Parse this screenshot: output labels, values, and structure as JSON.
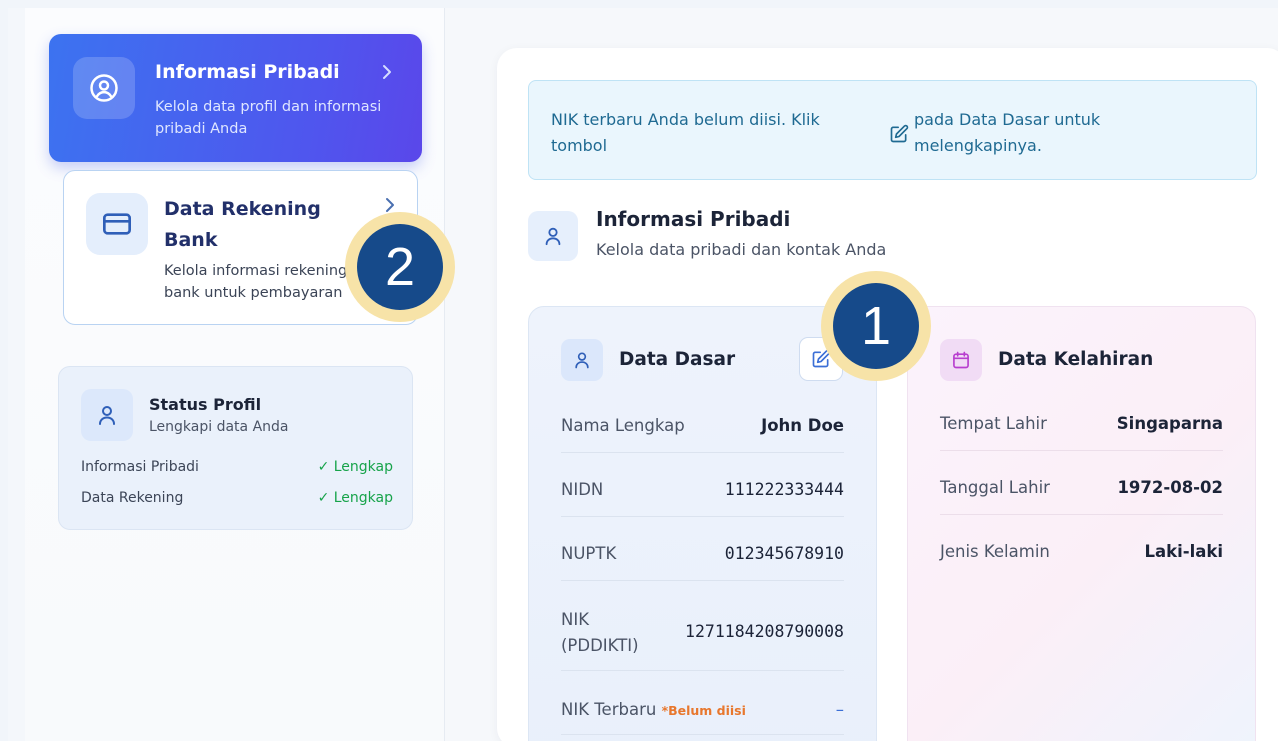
{
  "sidebar": {
    "items": [
      {
        "title": "Informasi Pribadi",
        "subtitle": "Kelola data profil dan informasi pribadi Anda",
        "icon": "user-circle-icon",
        "active": true
      },
      {
        "title": "Data Rekening Bank",
        "subtitle": "Kelola informasi rekening bank untuk pembayaran",
        "icon": "credit-card-icon",
        "active": false
      }
    ],
    "status": {
      "title": "Status Profil",
      "subtitle": "Lengkapi data Anda",
      "rows": [
        {
          "label": "Informasi Pribadi",
          "value": "✓ Lengkap"
        },
        {
          "label": "Data Rekening",
          "value": "✓ Lengkap"
        }
      ]
    }
  },
  "alert": {
    "text_before": "NIK terbaru Anda belum diisi. Klik tombol",
    "text_after": "pada Data Dasar untuk melengkapinya."
  },
  "section": {
    "title": "Informasi Pribadi",
    "subtitle": "Kelola data pribadi dan kontak Anda"
  },
  "data_dasar": {
    "title": "Data Dasar",
    "rows": [
      {
        "label": "Nama Lengkap",
        "value": "John Doe"
      },
      {
        "label": "NIDN",
        "value": "111222333444"
      },
      {
        "label": "NUPTK",
        "value": "012345678910"
      },
      {
        "label": "NIK (PDDIKTI)",
        "value": "1271184208790008"
      },
      {
        "label": "NIK Terbaru",
        "required_note": "*Belum diisi",
        "value": "–"
      }
    ]
  },
  "data_kelahiran": {
    "title": "Data Kelahiran",
    "rows": [
      {
        "label": "Tempat Lahir",
        "value": "Singaparna"
      },
      {
        "label": "Tanggal Lahir",
        "value": "1972-08-02"
      },
      {
        "label": "Jenis Kelamin",
        "value": "Laki-laki"
      }
    ]
  },
  "markers": [
    "1",
    "2"
  ],
  "colors": {
    "accent": "#4f56ee",
    "success": "#17a34a",
    "warning": "#e8772d",
    "marker_fill": "#164a8a",
    "marker_ring": "#f7e3a8"
  }
}
